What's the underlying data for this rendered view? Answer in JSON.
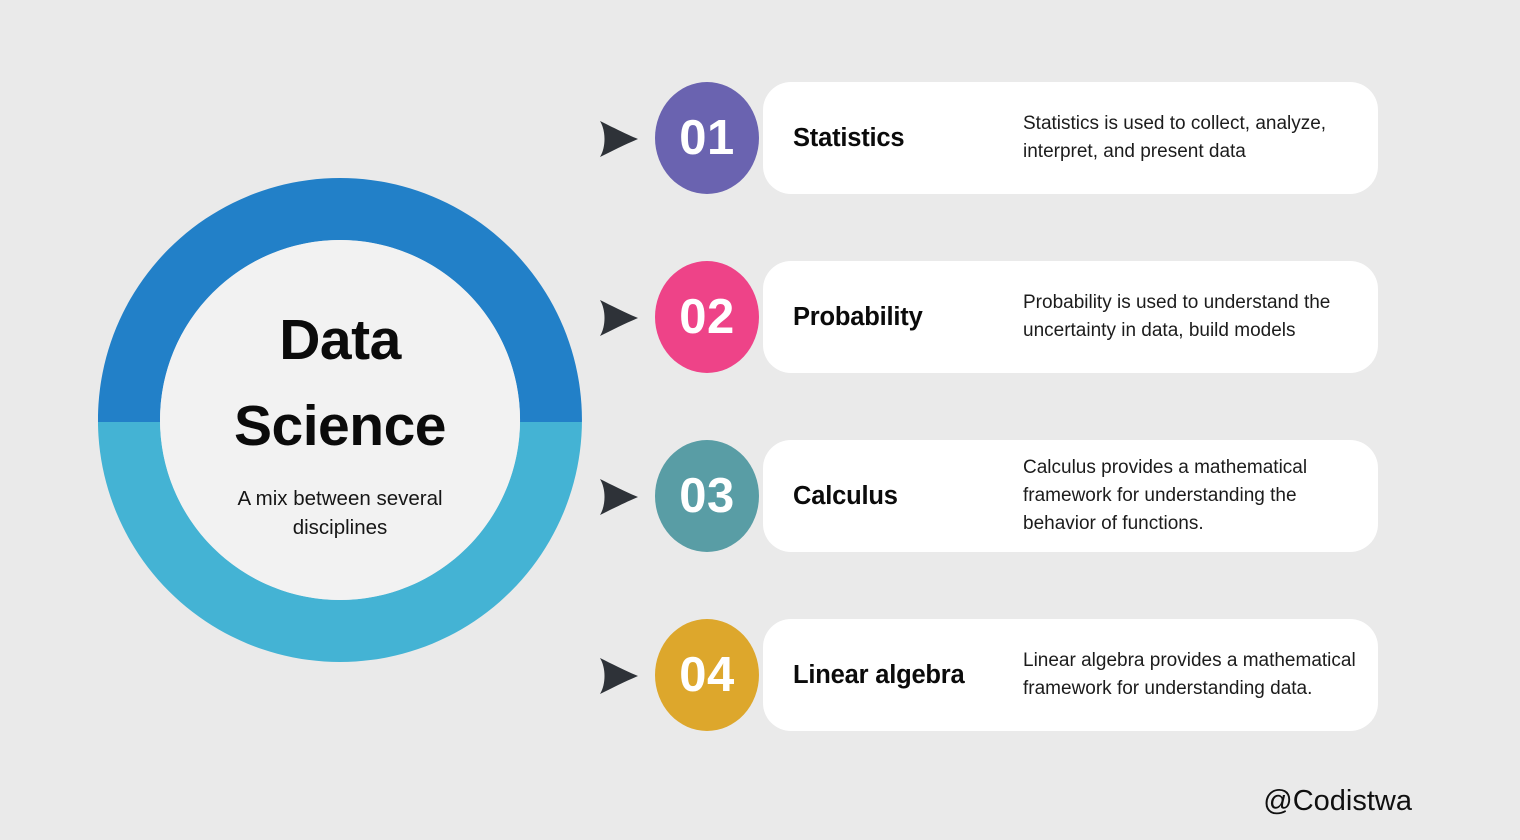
{
  "background_color": "#eaeaea",
  "center": {
    "title": "Data Science",
    "subtitle": "A mix between several disciplines",
    "donut": {
      "top_half_color": "#2280c8",
      "bottom_half_color": "#44b3d4",
      "inner_color": "#f2f2f2"
    }
  },
  "rows": [
    {
      "number": "01",
      "badge_color": "#6a63b0",
      "title": "Statistics",
      "description": "Statistics is used to collect, analyze, interpret, and present data",
      "arrow_icon": "arrow-right-icon"
    },
    {
      "number": "02",
      "badge_color": "#ee4388",
      "title": "Probability",
      "description": "Probability is used to understand the uncertainty in data, build models",
      "arrow_icon": "arrow-right-icon"
    },
    {
      "number": "03",
      "badge_color": "#599da5",
      "title": "Calculus",
      "description": "Calculus provides a mathematical framework for understanding the behavior of functions.",
      "arrow_icon": "arrow-right-icon"
    },
    {
      "number": "04",
      "badge_color": "#dda72c",
      "title": "Linear algebra",
      "description": "Linear algebra provides a mathematical framework for understanding data.",
      "arrow_icon": "arrow-right-icon"
    }
  ],
  "watermark": "@Codistwa",
  "chart_data": {
    "type": "pie",
    "title": "Data Science",
    "subtitle": "A mix between several disciplines",
    "categories": [
      "Upper half",
      "Lower half"
    ],
    "values": [
      50,
      50
    ],
    "colors": [
      "#2280c8",
      "#44b3d4"
    ],
    "legend": "none",
    "donut": true
  }
}
